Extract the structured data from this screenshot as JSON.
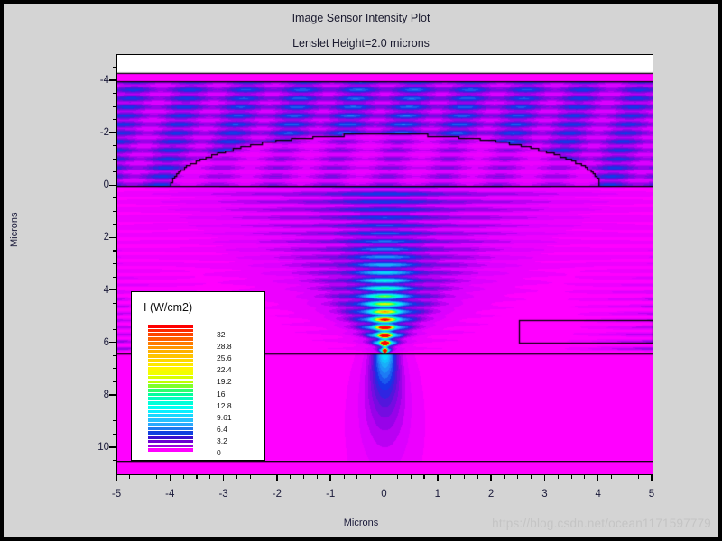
{
  "window": {
    "background_color": "#d4d4d4",
    "border_color": "#000000"
  },
  "header": {
    "title": "Image Sensor Intensity Plot",
    "subtitle": "Lenslet Height=2.0 microns"
  },
  "watermark": {
    "text": "https://blog.csdn.net/ocean1171597779"
  },
  "legend": {
    "title": "I (W/cm2)",
    "labels": [
      "32",
      "28.8",
      "25.6",
      "22.4",
      "19.2",
      "16",
      "12.8",
      "9.61",
      "6.4",
      "3.2",
      "0"
    ],
    "values": [
      32,
      28.8,
      25.6,
      22.4,
      19.2,
      16,
      12.8,
      9.61,
      6.4,
      3.2,
      0
    ],
    "band_count": 30,
    "colors": [
      "#ff0000",
      "#ff2a00",
      "#ff4500",
      "#ff6000",
      "#ff7b00",
      "#ff9500",
      "#ffb000",
      "#ffc400",
      "#ffd700",
      "#ffe800",
      "#fff700",
      "#f2ff00",
      "#d9ff00",
      "#bfff00",
      "#7fff2b",
      "#2bff6e",
      "#00ff9d",
      "#00ffbe",
      "#00ffd9",
      "#00fff2",
      "#0af0ff",
      "#18d8ff",
      "#26c0ff",
      "#2aa8ff",
      "#1e78f0",
      "#1040e0",
      "#3a10d0",
      "#6a00d0",
      "#9b00dd",
      "#ff00ff"
    ]
  },
  "chart_data": {
    "type": "heatmap",
    "title": "Image Sensor Intensity Plot",
    "subtitle": "Lenslet Height=2.0 microns",
    "xlabel": "Microns",
    "ylabel": "Microns",
    "xlim": [
      -5,
      5
    ],
    "ylim": [
      11,
      -5
    ],
    "y_axis_inverted": true,
    "grid": false,
    "colorbar_label": "I (W/cm2)",
    "colorbar_range": [
      0,
      32
    ],
    "x_ticks": [
      -5,
      -4,
      -3,
      -2,
      -1,
      0,
      1,
      2,
      3,
      4,
      5
    ],
    "x_tick_labels": [
      "-5",
      "-4",
      "-3",
      "-2",
      "-1",
      "0",
      "1",
      "2",
      "3",
      "4",
      "5"
    ],
    "x_minor_per_major": 4,
    "y_ticks": [
      -4,
      -2,
      0,
      2,
      4,
      6,
      8,
      10
    ],
    "y_tick_labels": [
      "-4",
      "-2",
      "0",
      "2",
      "4",
      "6",
      "8",
      "10"
    ],
    "y_minor_per_major": 4,
    "regions": [
      {
        "name": "blank-top-strip",
        "y_from": -5.0,
        "y_to": -4.3,
        "fill": "#ffffff"
      },
      {
        "name": "upper-magenta-band",
        "y_from": -4.3,
        "y_to": -4.0,
        "fill": "#ff00ff"
      },
      {
        "name": "incident-field",
        "y_from": -4.0,
        "y_to": 0.0
      },
      {
        "name": "substrate-field",
        "y_from": 0.0,
        "y_to": 6.4
      },
      {
        "name": "detector-layer",
        "y_from": 6.4,
        "y_to": 10.5
      },
      {
        "name": "base-layer",
        "y_from": 10.5,
        "y_to": 11.0
      }
    ],
    "boundary_lines_y": [
      -4.0,
      0.0,
      6.4,
      10.5
    ],
    "lenslet": {
      "shape": "stair-stepped dome",
      "x_from": -4.0,
      "x_to": 4.0,
      "base_y": 0.0,
      "apex_y": -2.0,
      "height_microns": 2.0,
      "steps": 26
    },
    "right_rectangle": {
      "x_from": 2.5,
      "x_to": 5.0,
      "y_from": 5.1,
      "y_to": 5.95
    },
    "focus": {
      "x": 0.0,
      "y": 6.25,
      "peak_intensity": 32,
      "description": "bright interference focal spot above detector boundary"
    }
  }
}
